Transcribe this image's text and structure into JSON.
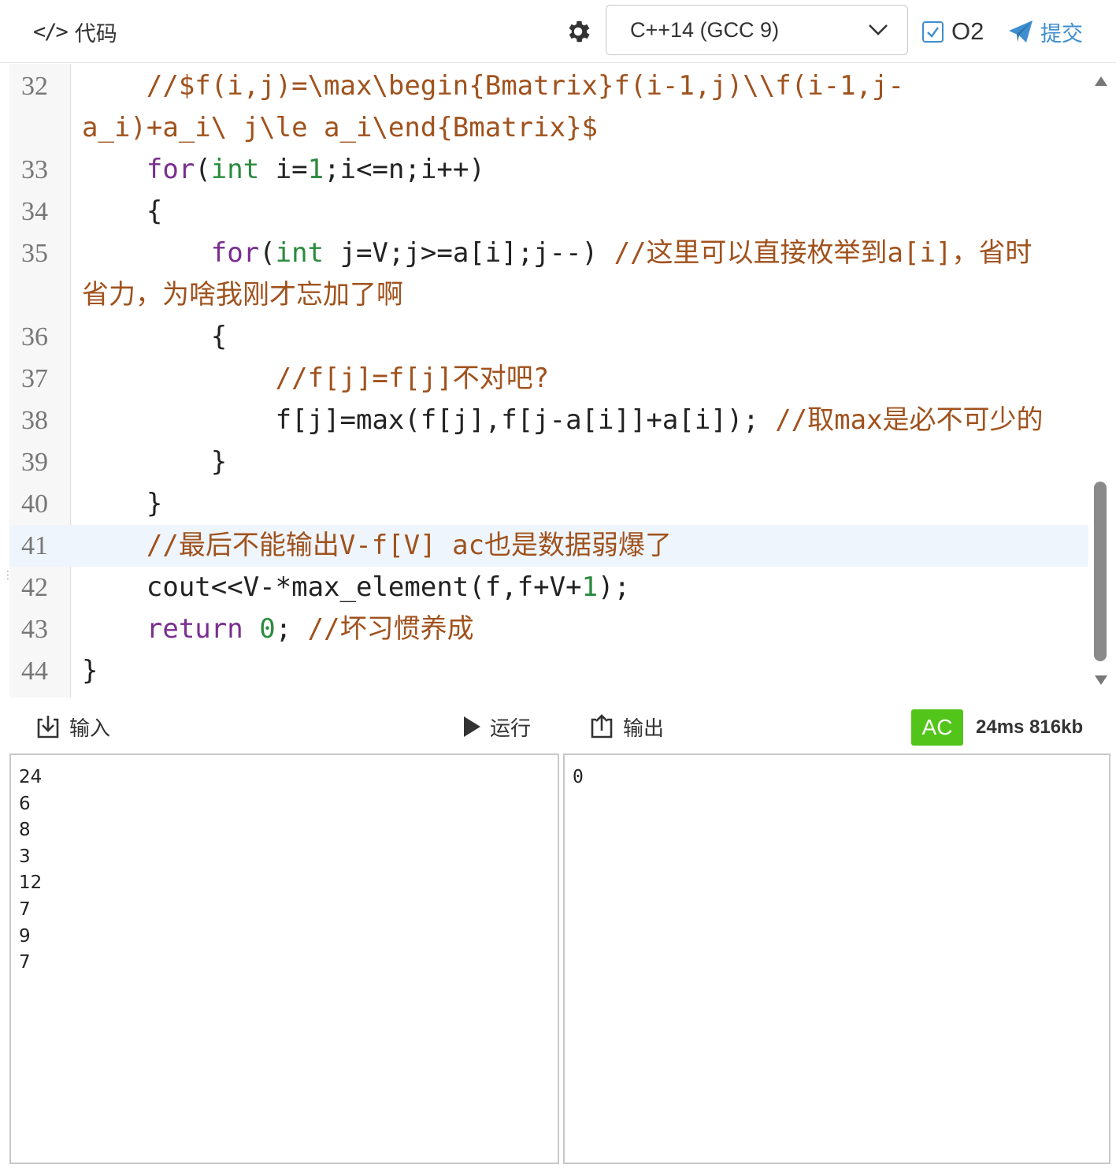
{
  "toolbar": {
    "code_icon": "</>",
    "code_label": "代码",
    "settings_icon": "gear-icon",
    "language": "C++14 (GCC 9)",
    "o2_label": "O2",
    "o2_checked": true,
    "submit_label": "提交"
  },
  "editor": {
    "lines": [
      {
        "num": "32",
        "segments": [
          {
            "t": "    //$f(i,j)=\\max\\begin{Bmatrix}f(i-1,j)\\\\f(i-1,j-",
            "c": "cm"
          }
        ]
      },
      {
        "num": "",
        "segments": [
          {
            "t": "a_i)+a_i\\ j\\le a_i\\end{Bmatrix}$",
            "c": "cm"
          }
        ]
      },
      {
        "num": "33",
        "segments": [
          {
            "t": "    ",
            "c": ""
          },
          {
            "t": "for",
            "c": "kw"
          },
          {
            "t": "(",
            "c": ""
          },
          {
            "t": "int",
            "c": "ty"
          },
          {
            "t": " i=",
            "c": ""
          },
          {
            "t": "1",
            "c": "nm"
          },
          {
            "t": ";i<=n;i++)",
            "c": ""
          }
        ]
      },
      {
        "num": "34",
        "segments": [
          {
            "t": "    {",
            "c": ""
          }
        ]
      },
      {
        "num": "35",
        "segments": [
          {
            "t": "        ",
            "c": ""
          },
          {
            "t": "for",
            "c": "kw"
          },
          {
            "t": "(",
            "c": ""
          },
          {
            "t": "int",
            "c": "ty"
          },
          {
            "t": " j=V;j>=a[i];j--) ",
            "c": ""
          },
          {
            "t": "//这里可以直接枚举到a[i]，省时",
            "c": "cm"
          }
        ]
      },
      {
        "num": "",
        "segments": [
          {
            "t": "省力，为啥我刚才忘加了啊",
            "c": "cm"
          }
        ]
      },
      {
        "num": "36",
        "segments": [
          {
            "t": "        {",
            "c": ""
          }
        ]
      },
      {
        "num": "37",
        "segments": [
          {
            "t": "            ",
            "c": ""
          },
          {
            "t": "//f[j]=f[j]不对吧?",
            "c": "cm"
          }
        ]
      },
      {
        "num": "38",
        "segments": [
          {
            "t": "            f[j]=max(f[j],f[j-a[i]]+a[i]); ",
            "c": ""
          },
          {
            "t": "//取max是必不可少的",
            "c": "cm"
          }
        ]
      },
      {
        "num": "39",
        "segments": [
          {
            "t": "        }",
            "c": ""
          }
        ]
      },
      {
        "num": "40",
        "segments": [
          {
            "t": "    }",
            "c": ""
          }
        ]
      },
      {
        "num": "41",
        "segments": [
          {
            "t": "    ",
            "c": ""
          },
          {
            "t": "//最后不能输出V-f[V] ac也是数据弱爆了",
            "c": "cm"
          }
        ]
      },
      {
        "num": "42",
        "segments": [
          {
            "t": "    cout<<V-*max_element(f,f+V+",
            "c": ""
          },
          {
            "t": "1",
            "c": "nm"
          },
          {
            "t": ");",
            "c": ""
          }
        ]
      },
      {
        "num": "43",
        "segments": [
          {
            "t": "    ",
            "c": ""
          },
          {
            "t": "return",
            "c": "kw"
          },
          {
            "t": " ",
            "c": ""
          },
          {
            "t": "0",
            "c": "nm"
          },
          {
            "t": "; ",
            "c": ""
          },
          {
            "t": "//坏习惯养成",
            "c": "cm"
          }
        ]
      },
      {
        "num": "44",
        "segments": [
          {
            "t": "}",
            "c": ""
          }
        ]
      }
    ],
    "active_line": "41"
  },
  "io": {
    "input_label": "输入",
    "run_label": "运行",
    "output_label": "输出",
    "status": "AC",
    "stats": "24ms 816kb",
    "status_color": "#52c41a",
    "input_lines": [
      "24",
      "6",
      "8",
      "3",
      "12",
      "7",
      "9",
      "7"
    ],
    "output_lines": [
      "0"
    ]
  }
}
